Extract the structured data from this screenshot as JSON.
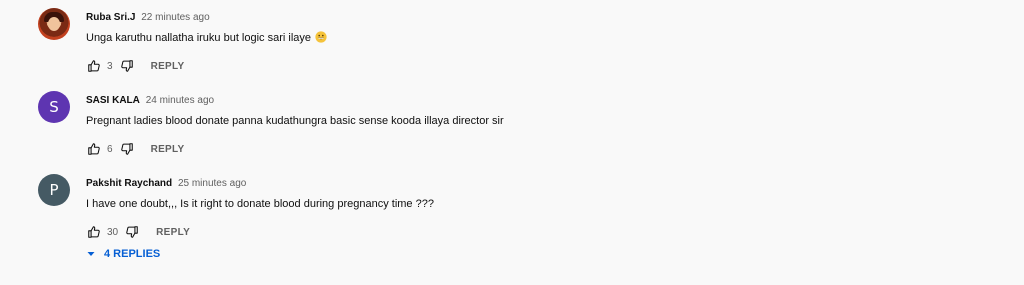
{
  "comments": [
    {
      "author": "Ruba Sri.J",
      "time": "22 minutes ago",
      "text": "Unga karuthu nallatha iruku but logic sari ilaye",
      "emoji": "grinning-face-emoji",
      "likes": "3",
      "reply_label": "REPLY",
      "avatar": {
        "type": "photo"
      }
    },
    {
      "author": "SASI KALA",
      "time": "24 minutes ago",
      "text": "Pregnant ladies blood donate panna kudathungra basic sense kooda illaya director sir",
      "likes": "6",
      "reply_label": "REPLY",
      "avatar": {
        "type": "letter",
        "letter": "S",
        "color": "#5e35b1"
      }
    },
    {
      "author": "Pakshit Raychand",
      "time": "25 minutes ago",
      "text": "I have one doubt,,, Is it right to donate blood during pregnancy time ???",
      "likes": "30",
      "reply_label": "REPLY",
      "avatar": {
        "type": "letter",
        "letter": "P",
        "color": "#455a64"
      }
    }
  ],
  "replies_toggle": {
    "label": "4 REPLIES",
    "icon": "caret-down-icon",
    "color": "#065fd4"
  },
  "icons": {
    "like": "thumb-up-icon",
    "dislike": "thumb-down-icon"
  }
}
